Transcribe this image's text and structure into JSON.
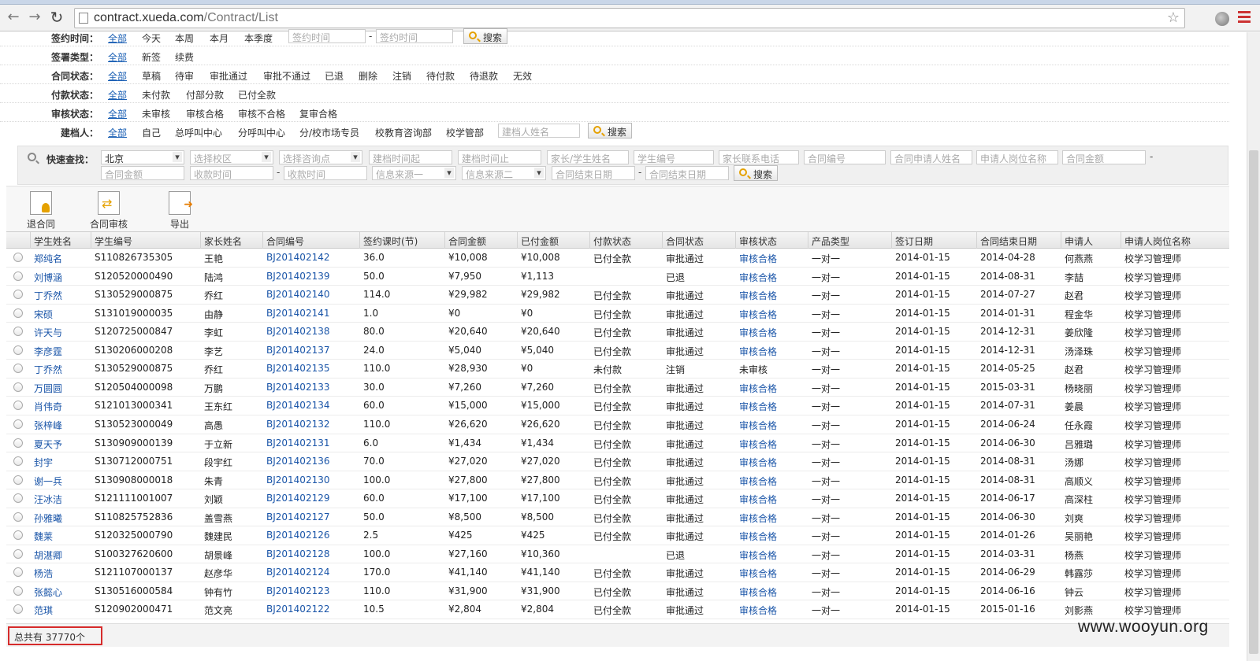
{
  "browser": {
    "url_host": "contract.xueda.com",
    "url_path": "/Contract/List"
  },
  "filters": {
    "sign_time": {
      "label": "签约时间：",
      "options": [
        "全部",
        "今天",
        "本周",
        "本月",
        "本季度"
      ],
      "start_placeholder": "签约时间",
      "end_placeholder": "签约时间",
      "search": "搜索"
    },
    "sign_type": {
      "label": "签署类型：",
      "options": [
        "全部",
        "新签",
        "续费"
      ]
    },
    "contract_status": {
      "label": "合同状态：",
      "options": [
        "全部",
        "草稿",
        "待审",
        "审批通过",
        "审批不通过",
        "已退",
        "删除",
        "注销",
        "待付款",
        "待退款",
        "无效"
      ]
    },
    "pay_status": {
      "label": "付款状态：",
      "options": [
        "全部",
        "未付款",
        "付部分款",
        "已付全款"
      ]
    },
    "audit_status": {
      "label": "审核状态：",
      "options": [
        "全部",
        "未审核",
        "审核合格",
        "审核不合格",
        "复审合格"
      ]
    },
    "creator": {
      "label": "建档人：",
      "options": [
        "全部",
        "自己",
        "总呼叫中心",
        "分呼叫中心",
        "分/校市场专员",
        "校教育咨询部",
        "校学管部"
      ],
      "placeholder": "建档人姓名",
      "search": "搜索"
    }
  },
  "quick": {
    "label": "快速查找：",
    "city": "北京",
    "campus": "选择校区",
    "consult": "选择咨询点",
    "create_from": "建档时间起",
    "create_to": "建档时间止",
    "parent_student": "家长/学生姓名",
    "student_no": "学生编号",
    "parent_phone": "家长联系电话",
    "contract_no": "合同编号",
    "applicant": "合同申请人姓名",
    "applicant_post": "申请人岗位名称",
    "amount_from": "合同金额",
    "amount_to": "合同金额",
    "collect_from": "收款时间",
    "collect_to": "收款时间",
    "source1": "信息来源一",
    "source2": "信息来源二",
    "end_from": "合同结束日期",
    "end_to": "合同结束日期",
    "search": "搜索",
    "dash": "-"
  },
  "actions": {
    "refund": "退合同",
    "review": "合同审核",
    "export": "导出"
  },
  "columns": [
    "学生姓名",
    "学生编号",
    "家长姓名",
    "合同编号",
    "签约课时(节)",
    "合同金额",
    "已付金额",
    "付款状态",
    "合同状态",
    "审核状态",
    "产品类型",
    "签订日期",
    "合同结束日期",
    "申请人",
    "申请人岗位名称"
  ],
  "rows": [
    [
      "郑纯名",
      "S110826735305",
      "王艳",
      "BJ201402142",
      "36.0",
      "¥10,008",
      "¥10,008",
      "已付全款",
      "审批通过",
      "审核合格",
      "一对一",
      "2014-01-15",
      "2014-04-28",
      "何燕燕",
      "校学习管理师"
    ],
    [
      "刘博涵",
      "S120520000490",
      "陆鸿",
      "BJ201402139",
      "50.0",
      "¥7,950",
      "¥1,113",
      "",
      "已退",
      "审核合格",
      "一对一",
      "2014-01-15",
      "2014-08-31",
      "李喆",
      "校学习管理师"
    ],
    [
      "丁乔然",
      "S130529000875",
      "乔红",
      "BJ201402140",
      "114.0",
      "¥29,982",
      "¥29,982",
      "已付全款",
      "审批通过",
      "审核合格",
      "一对一",
      "2014-01-15",
      "2014-07-27",
      "赵君",
      "校学习管理师"
    ],
    [
      "宋硕",
      "S131019000035",
      "由静",
      "BJ201402141",
      "1.0",
      "¥0",
      "¥0",
      "已付全款",
      "审批通过",
      "审核合格",
      "一对一",
      "2014-01-15",
      "2014-01-31",
      "程金华",
      "校学习管理师"
    ],
    [
      "许天与",
      "S120725000847",
      "李虹",
      "BJ201402138",
      "80.0",
      "¥20,640",
      "¥20,640",
      "已付全款",
      "审批通过",
      "审核合格",
      "一对一",
      "2014-01-15",
      "2014-12-31",
      "姜欣隆",
      "校学习管理师"
    ],
    [
      "李彦霆",
      "S130206000208",
      "李艺",
      "BJ201402137",
      "24.0",
      "¥5,040",
      "¥5,040",
      "已付全款",
      "审批通过",
      "审核合格",
      "一对一",
      "2014-01-15",
      "2014-12-31",
      "汤泽珠",
      "校学习管理师"
    ],
    [
      "丁乔然",
      "S130529000875",
      "乔红",
      "BJ201402135",
      "110.0",
      "¥28,930",
      "¥0",
      "未付款",
      "注销",
      "未审核",
      "一对一",
      "2014-01-15",
      "2014-05-25",
      "赵君",
      "校学习管理师"
    ],
    [
      "万圆圆",
      "S120504000098",
      "万鹏",
      "BJ201402133",
      "30.0",
      "¥7,260",
      "¥7,260",
      "已付全款",
      "审批通过",
      "审核合格",
      "一对一",
      "2014-01-15",
      "2015-03-31",
      "杨晓丽",
      "校学习管理师"
    ],
    [
      "肖伟奇",
      "S121013000341",
      "王东红",
      "BJ201402134",
      "60.0",
      "¥15,000",
      "¥15,000",
      "已付全款",
      "审批通过",
      "审核合格",
      "一对一",
      "2014-01-15",
      "2014-07-31",
      "姜晨",
      "校学习管理师"
    ],
    [
      "张梓峰",
      "S130523000049",
      "高愚",
      "BJ201402132",
      "110.0",
      "¥26,620",
      "¥26,620",
      "已付全款",
      "审批通过",
      "审核合格",
      "一对一",
      "2014-01-15",
      "2014-06-24",
      "任永霞",
      "校学习管理师"
    ],
    [
      "夏天予",
      "S130909000139",
      "于立新",
      "BJ201402131",
      "6.0",
      "¥1,434",
      "¥1,434",
      "已付全款",
      "审批通过",
      "审核合格",
      "一对一",
      "2014-01-15",
      "2014-06-30",
      "吕雅璐",
      "校学习管理师"
    ],
    [
      "封宇",
      "S130712000751",
      "段宇红",
      "BJ201402136",
      "70.0",
      "¥27,020",
      "¥27,020",
      "已付全款",
      "审批通过",
      "审核合格",
      "一对一",
      "2014-01-15",
      "2014-08-31",
      "汤娜",
      "校学习管理师"
    ],
    [
      "谢一兵",
      "S130908000018",
      "朱青",
      "BJ201402130",
      "100.0",
      "¥27,800",
      "¥27,800",
      "已付全款",
      "审批通过",
      "审核合格",
      "一对一",
      "2014-01-15",
      "2014-08-31",
      "高顺义",
      "校学习管理师"
    ],
    [
      "汪冰洁",
      "S121111001007",
      "刘颖",
      "BJ201402129",
      "60.0",
      "¥17,100",
      "¥17,100",
      "已付全款",
      "审批通过",
      "审核合格",
      "一对一",
      "2014-01-15",
      "2014-06-17",
      "高深柱",
      "校学习管理师"
    ],
    [
      "孙雅曦",
      "S110825752836",
      "盖雪燕",
      "BJ201402127",
      "50.0",
      "¥8,500",
      "¥8,500",
      "已付全款",
      "审批通过",
      "审核合格",
      "一对一",
      "2014-01-15",
      "2014-06-30",
      "刘爽",
      "校学习管理师"
    ],
    [
      "魏莱",
      "S120325000790",
      "魏建民",
      "BJ201402126",
      "2.5",
      "¥425",
      "¥425",
      "已付全款",
      "审批通过",
      "审核合格",
      "一对一",
      "2014-01-15",
      "2014-01-26",
      "吴丽艳",
      "校学习管理师"
    ],
    [
      "胡湛卿",
      "S100327620600",
      "胡景峰",
      "BJ201402128",
      "100.0",
      "¥27,160",
      "¥10,360",
      "",
      "已退",
      "审核合格",
      "一对一",
      "2014-01-15",
      "2014-03-31",
      "杨燕",
      "校学习管理师"
    ],
    [
      "杨浩",
      "S121107000137",
      "赵彦华",
      "BJ201402124",
      "170.0",
      "¥41,140",
      "¥41,140",
      "已付全款",
      "审批通过",
      "审核合格",
      "一对一",
      "2014-01-15",
      "2014-06-29",
      "韩露莎",
      "校学习管理师"
    ],
    [
      "张懿心",
      "S130516000584",
      "钟有竹",
      "BJ201402123",
      "110.0",
      "¥31,900",
      "¥31,900",
      "已付全款",
      "审批通过",
      "审核合格",
      "一对一",
      "2014-01-15",
      "2014-06-16",
      "钟云",
      "校学习管理师"
    ],
    [
      "范琪",
      "S120902000471",
      "范文亮",
      "BJ201402122",
      "10.5",
      "¥2,804",
      "¥2,804",
      "已付全款",
      "审批通过",
      "审核合格",
      "一对一",
      "2014-01-15",
      "2015-01-16",
      "刘影燕",
      "校学习管理师"
    ]
  ],
  "footer": {
    "total": "总共有 37770个"
  },
  "watermark": "www.wooyun.org"
}
